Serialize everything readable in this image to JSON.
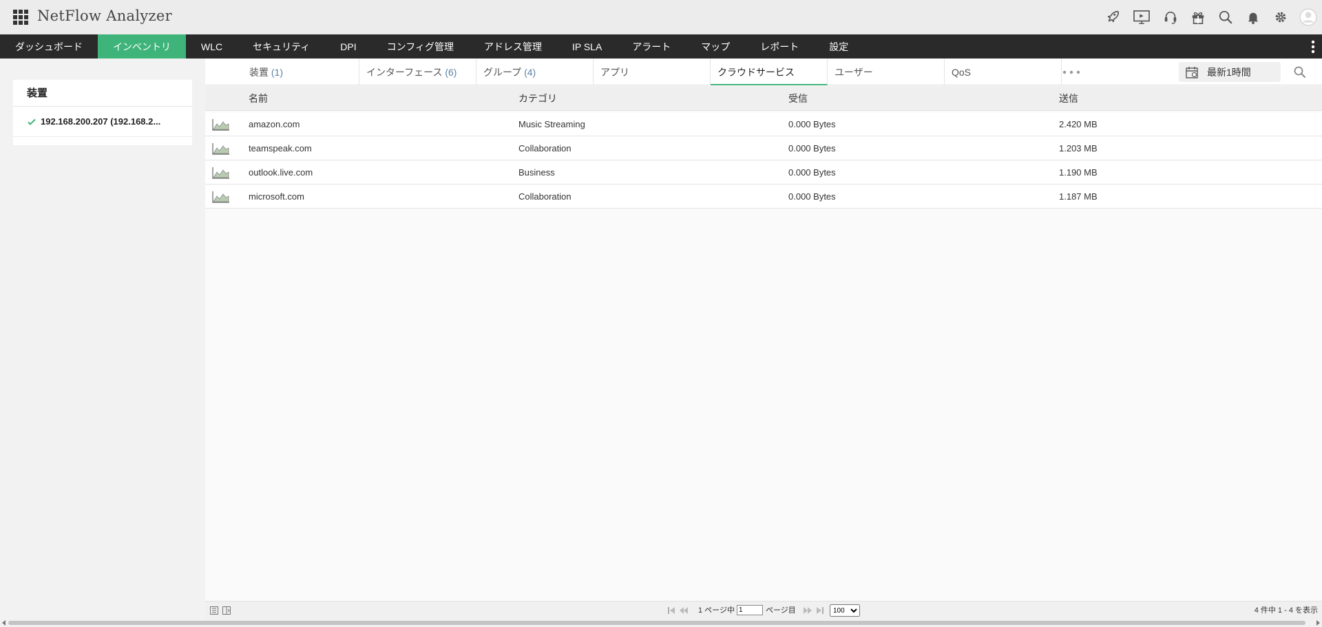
{
  "header": {
    "title": "NetFlow Analyzer",
    "icons": [
      "rocket-icon",
      "presentation-icon",
      "support-headset-icon",
      "gift-icon",
      "search-icon",
      "bell-icon",
      "gear-icon",
      "user-avatar-icon"
    ]
  },
  "nav": {
    "items": [
      {
        "label": "ダッシュボード",
        "active": false
      },
      {
        "label": "インベントリ",
        "active": true
      },
      {
        "label": "WLC",
        "active": false
      },
      {
        "label": "セキュリティ",
        "active": false
      },
      {
        "label": "DPI",
        "active": false
      },
      {
        "label": "コンフィグ管理",
        "active": false
      },
      {
        "label": "アドレス管理",
        "active": false
      },
      {
        "label": "IP SLA",
        "active": false
      },
      {
        "label": "アラート",
        "active": false
      },
      {
        "label": "マップ",
        "active": false
      },
      {
        "label": "レポート",
        "active": false
      },
      {
        "label": "設定",
        "active": false
      }
    ],
    "active_color": "#3fb47a"
  },
  "sidebar": {
    "heading": "装置",
    "selected_device": "192.168.200.207 (192.168.2..."
  },
  "subtabs": [
    {
      "label": "装置",
      "count": "(1)"
    },
    {
      "label": "インターフェース",
      "count": "(6)"
    },
    {
      "label": "グループ",
      "count": "(4)"
    },
    {
      "label": "アプリ",
      "count": ""
    },
    {
      "label": "クラウドサービス",
      "count": "",
      "active": true
    },
    {
      "label": "ユーザー",
      "count": ""
    },
    {
      "label": "QoS",
      "count": ""
    }
  ],
  "time_filter": "最新1時間",
  "table": {
    "columns": [
      "名前",
      "カテゴリ",
      "受信",
      "送信"
    ],
    "rows": [
      {
        "name": "amazon.com",
        "category": "Music Streaming",
        "received": "0.000 Bytes",
        "sent": "2.420 MB"
      },
      {
        "name": "teamspeak.com",
        "category": "Collaboration",
        "received": "0.000 Bytes",
        "sent": "1.203 MB"
      },
      {
        "name": "outlook.live.com",
        "category": "Business",
        "received": "0.000 Bytes",
        "sent": "1.190 MB"
      },
      {
        "name": "microsoft.com",
        "category": "Collaboration",
        "received": "0.000 Bytes",
        "sent": "1.187 MB"
      }
    ]
  },
  "pager": {
    "total_pages_text": "1 ページ中",
    "current_page": "1",
    "page_suffix": "ページ目",
    "page_size": "100",
    "page_size_options": [
      "100"
    ],
    "summary": "4 件中 1 - 4 を表示"
  }
}
